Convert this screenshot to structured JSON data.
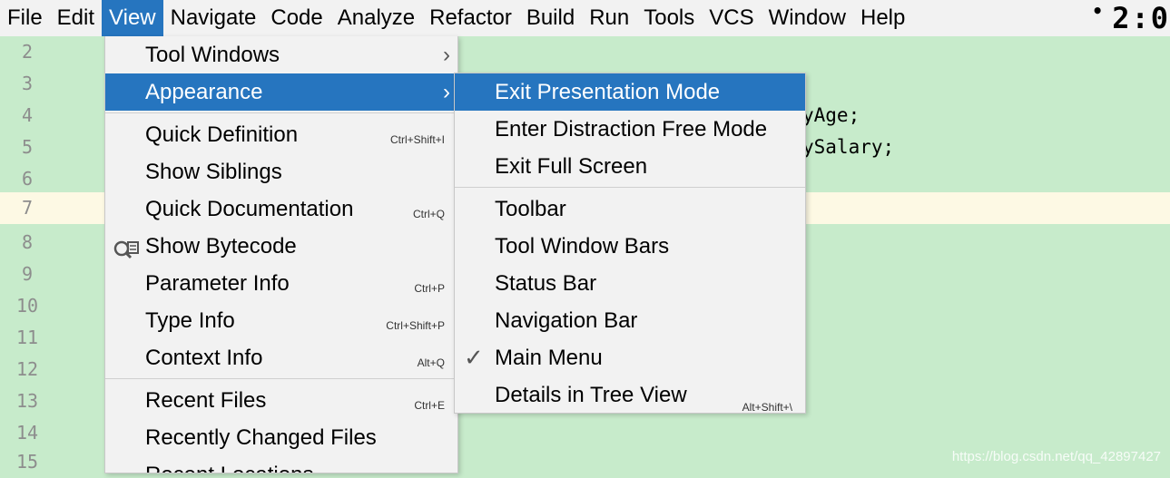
{
  "menubar": {
    "items": [
      {
        "label": "File",
        "active": false
      },
      {
        "label": "Edit",
        "active": false
      },
      {
        "label": "View",
        "active": true
      },
      {
        "label": "Navigate",
        "active": false
      },
      {
        "label": "Code",
        "active": false
      },
      {
        "label": "Analyze",
        "active": false
      },
      {
        "label": "Refactor",
        "active": false
      },
      {
        "label": "Build",
        "active": false
      },
      {
        "label": "Run",
        "active": false
      },
      {
        "label": "Tools",
        "active": false
      },
      {
        "label": "VCS",
        "active": false
      },
      {
        "label": "Window",
        "active": false
      },
      {
        "label": "Help",
        "active": false
      }
    ],
    "clock": "2:0"
  },
  "editor": {
    "lines": [
      "2",
      "3",
      "4",
      "5",
      "6",
      "7",
      "8",
      "9",
      "10",
      "11",
      "12",
      "13",
      "14",
      "15"
    ],
    "current_line": "7",
    "code_line_4": "yAge;",
    "code_line_5": "ySalary;"
  },
  "view_menu": {
    "items": [
      {
        "label": "Tool Windows",
        "shortcut": "",
        "submenu": true
      },
      {
        "label": "Appearance",
        "shortcut": "",
        "submenu": true,
        "active": true
      },
      {
        "label": "Quick Definition",
        "shortcut": "Ctrl+Shift+I"
      },
      {
        "label": "Show Siblings",
        "shortcut": ""
      },
      {
        "label": "Quick Documentation",
        "shortcut": "Ctrl+Q"
      },
      {
        "label": "Show Bytecode",
        "shortcut": "",
        "icon": "bytecode-search-icon"
      },
      {
        "label": "Parameter Info",
        "shortcut": "Ctrl+P"
      },
      {
        "label": "Type Info",
        "shortcut": "Ctrl+Shift+P"
      },
      {
        "label": "Context Info",
        "shortcut": "Alt+Q"
      },
      {
        "label": "Recent Files",
        "shortcut": "Ctrl+E"
      },
      {
        "label": "Recently Changed Files",
        "shortcut": ""
      },
      {
        "label": "Recent Locations",
        "shortcut": ""
      }
    ]
  },
  "appearance_submenu": {
    "items": [
      {
        "label": "Exit Presentation Mode",
        "shortcut": "",
        "active": true
      },
      {
        "label": "Enter Distraction Free Mode",
        "shortcut": ""
      },
      {
        "label": "Exit Full Screen",
        "shortcut": ""
      },
      {
        "label": "Toolbar",
        "shortcut": ""
      },
      {
        "label": "Tool Window Bars",
        "shortcut": ""
      },
      {
        "label": "Status Bar",
        "shortcut": ""
      },
      {
        "label": "Navigation Bar",
        "shortcut": ""
      },
      {
        "label": "Main Menu",
        "shortcut": "",
        "checked": true
      },
      {
        "label": "Details in Tree View",
        "shortcut": "Alt+Shift+\\"
      }
    ]
  },
  "watermark": "https://blog.csdn.net/qq_42897427",
  "colors": {
    "accent": "#2675bf",
    "editor_bg": "#c7ebcb",
    "current_line": "#fdf9e4",
    "menu_bg": "#f2f2f2"
  }
}
